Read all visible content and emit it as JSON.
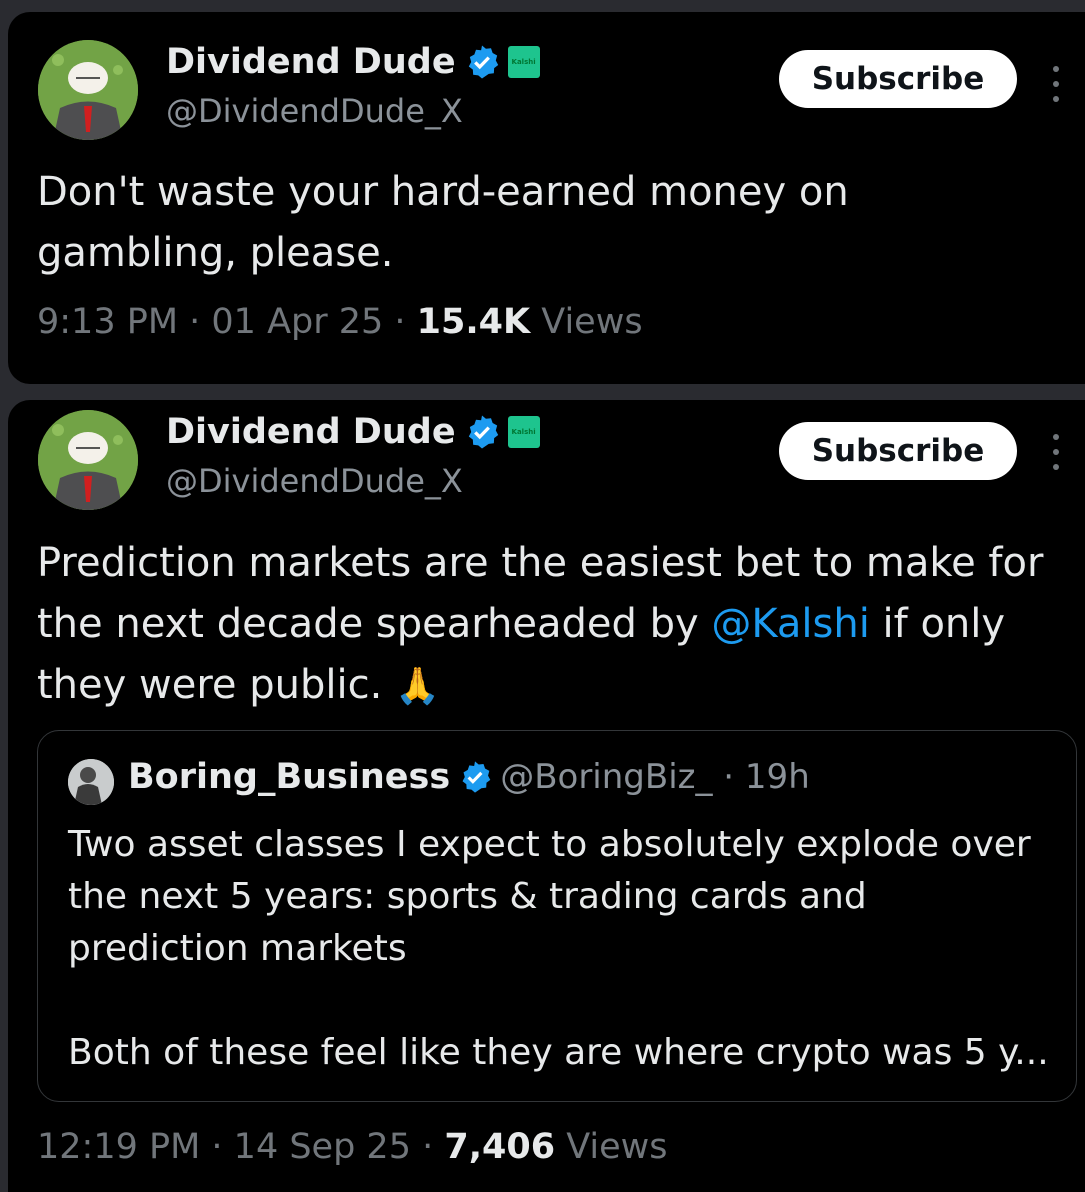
{
  "tweets": [
    {
      "author_name": "Dividend Dude",
      "handle": "@DividendDude_X",
      "badge_label": "Kalshi",
      "subscribe_label": "Subscribe",
      "text": "Don't waste your hard-earned money on gambling, please.",
      "time": "9:13 PM · 01 Apr 25 · ",
      "views_count": "15.4K",
      "views_label": " Views"
    },
    {
      "author_name": "Dividend Dude",
      "handle": "@DividendDude_X",
      "badge_label": "Kalshi",
      "subscribe_label": "Subscribe",
      "text_before": "Prediction markets are the easiest bet to make for the next decade spearheaded by ",
      "mention": "@Kalshi",
      "text_after": " if only they were public. ",
      "emoji": "🙏",
      "quote": {
        "author_name": "Boring_Business",
        "handle_time": "@BoringBiz_ · 19h",
        "text": "Two asset classes I expect to absolutely explode over the next 5 years: sports & trading cards and prediction markets\n\nBoth of these feel like they are where crypto was 5 y..."
      },
      "time": "12:19 PM · 14 Sep 25 · ",
      "views_count": "7,406",
      "views_label": " Views"
    }
  ],
  "colors": {
    "background": "#000000",
    "text": "#e7e9ea",
    "secondary": "#71767b",
    "link": "#1d9bf0",
    "verified": "#1d9bf0",
    "kalshi": "#1ec48e"
  }
}
